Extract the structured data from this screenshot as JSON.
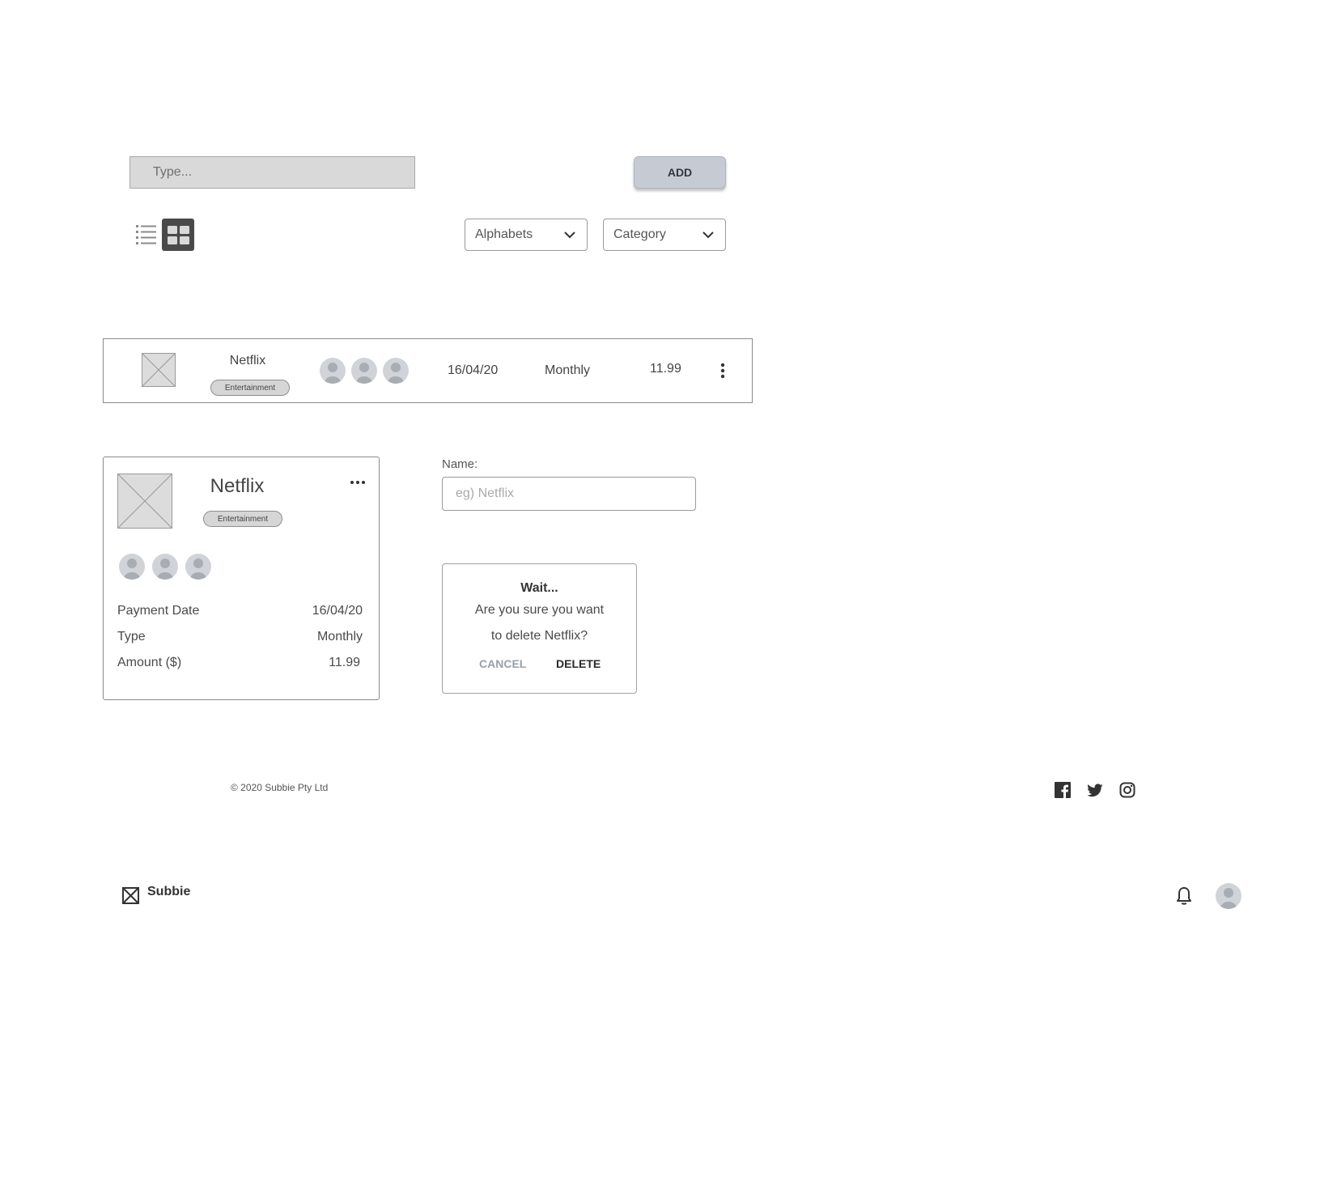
{
  "toolbar": {
    "input_placeholder": "Type...",
    "add_label": "ADD"
  },
  "filters": {
    "sort_selected": "Alphabets",
    "category_selected": "Category"
  },
  "list_row": {
    "name": "Netflix",
    "category": "Entertainment",
    "payment_date": "16/04/20",
    "type": "Monthly",
    "amount": "11.99"
  },
  "grid_card": {
    "name": "Netflix",
    "category": "Entertainment",
    "rows": [
      {
        "label": "Payment Date",
        "value": "16/04/20"
      },
      {
        "label": "Type",
        "value": "Monthly"
      },
      {
        "label": "Amount ($)",
        "value": "11.99"
      }
    ]
  },
  "name_field": {
    "label": "Name:",
    "placeholder": "eg) Netflix"
  },
  "confirm_dialog": {
    "title": "Wait...",
    "line1": "Are you sure you want",
    "line2": "to delete Netflix?",
    "cancel_label": "CANCEL",
    "delete_label": "DELETE"
  },
  "footer": {
    "copyright": "© 2020 Subbie Pty Ltd",
    "social_icons": [
      "facebook-icon",
      "twitter-icon",
      "instagram-icon"
    ]
  },
  "header": {
    "brand": "Subbie"
  },
  "colors": {
    "placeholder_fill": "#dcdcdc",
    "button_fill": "#c6cbd3",
    "active_toggle": "#4a4a4a",
    "muted_text": "#9aa0a8"
  }
}
